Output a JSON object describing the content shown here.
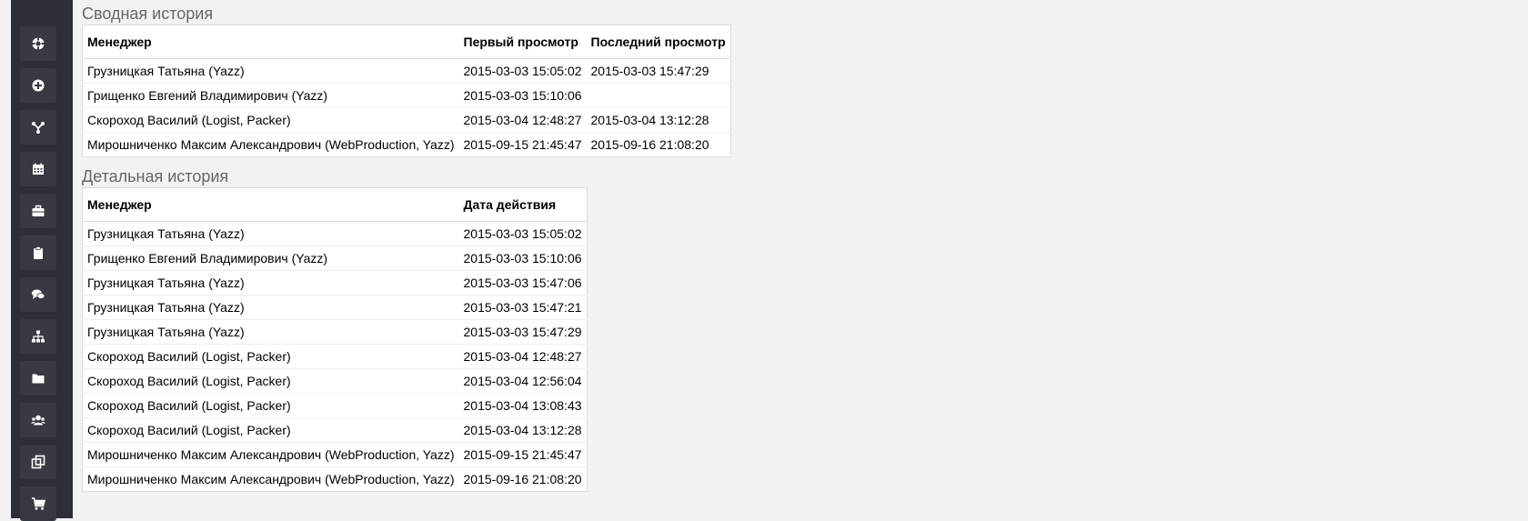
{
  "sidebar": {
    "items": [
      {
        "icon": "lifebuoy-icon"
      },
      {
        "icon": "plus-circle-icon"
      },
      {
        "icon": "branch-fork-icon"
      },
      {
        "icon": "calendar-icon"
      },
      {
        "icon": "briefcase-icon"
      },
      {
        "icon": "clipboard-icon"
      },
      {
        "icon": "chat-bubbles-icon"
      },
      {
        "icon": "sitemap-icon"
      },
      {
        "icon": "folder-icon"
      },
      {
        "icon": "users-group-icon"
      },
      {
        "icon": "copy-icon"
      },
      {
        "icon": "cart-icon"
      }
    ]
  },
  "summary": {
    "title": "Сводная история",
    "headers": {
      "manager": "Менеджер",
      "first_view": "Первый просмотр",
      "last_view": "Последний просмотр"
    },
    "rows": [
      {
        "manager": "Грузницкая Татьяна (Yazz)",
        "first": "2015-03-03 15:05:02",
        "last": "2015-03-03 15:47:29"
      },
      {
        "manager": "Грищенко Евгений Владимирович (Yazz)",
        "first": "2015-03-03 15:10:06",
        "last": ""
      },
      {
        "manager": "Скороход Василий (Logist, Packer)",
        "first": "2015-03-04 12:48:27",
        "last": "2015-03-04 13:12:28"
      },
      {
        "manager": "Мирошниченко Максим Александрович (WebProduction, Yazz)",
        "first": "2015-09-15 21:45:47",
        "last": "2015-09-16 21:08:20"
      }
    ]
  },
  "detail": {
    "title": "Детальная история",
    "headers": {
      "manager": "Менеджер",
      "action_date": "Дата действия"
    },
    "rows": [
      {
        "manager": "Грузницкая Татьяна (Yazz)",
        "date": "2015-03-03 15:05:02"
      },
      {
        "manager": "Грищенко Евгений Владимирович (Yazz)",
        "date": "2015-03-03 15:10:06"
      },
      {
        "manager": "Грузницкая Татьяна (Yazz)",
        "date": "2015-03-03 15:47:06"
      },
      {
        "manager": "Грузницкая Татьяна (Yazz)",
        "date": "2015-03-03 15:47:21"
      },
      {
        "manager": "Грузницкая Татьяна (Yazz)",
        "date": "2015-03-03 15:47:29"
      },
      {
        "manager": "Скороход Василий (Logist, Packer)",
        "date": "2015-03-04 12:48:27"
      },
      {
        "manager": "Скороход Василий (Logist, Packer)",
        "date": "2015-03-04 12:56:04"
      },
      {
        "manager": "Скороход Василий (Logist, Packer)",
        "date": "2015-03-04 13:08:43"
      },
      {
        "manager": "Скороход Василий (Logist, Packer)",
        "date": "2015-03-04 13:12:28"
      },
      {
        "manager": "Мирошниченко Максим Александрович (WebProduction, Yazz)",
        "date": "2015-09-15 21:45:47"
      },
      {
        "manager": "Мирошниченко Максим Александрович (WebProduction, Yazz)",
        "date": "2015-09-16 21:08:20"
      }
    ]
  }
}
